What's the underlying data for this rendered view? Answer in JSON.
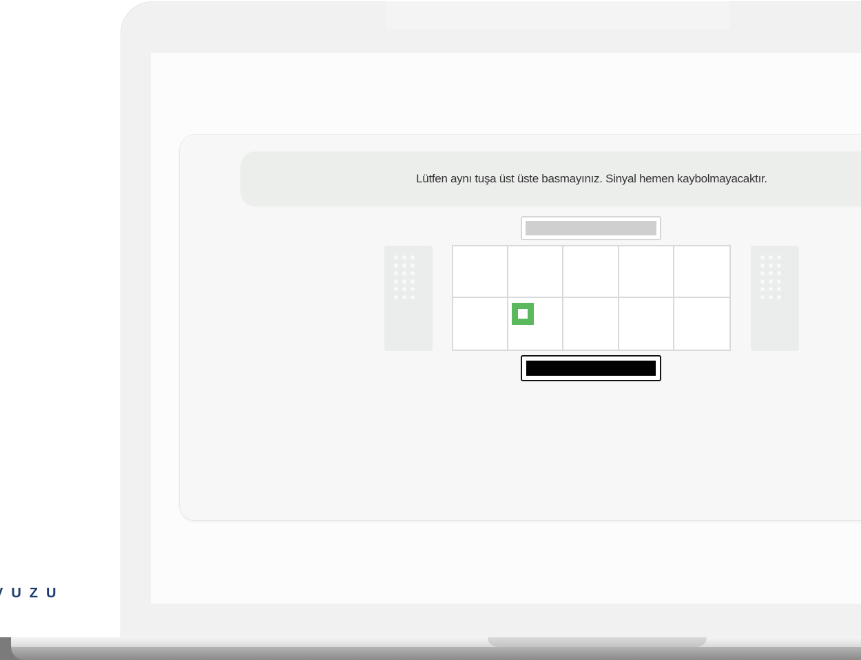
{
  "screen": {
    "banner": {
      "message": "Lütfen aynı tuşa üst üste basmayınız. Sinyal hemen kaybolmayacaktır."
    },
    "grid": {
      "rows": 2,
      "columns": 5,
      "active_signal": {
        "row": 2,
        "column": 2,
        "color": "#5cb85c"
      }
    },
    "top_indicator": {
      "state": "inactive",
      "color": "#cfcfcf"
    },
    "bottom_indicator": {
      "state": "active",
      "color": "#000000"
    }
  },
  "branding": {
    "logo_text": "VUZU",
    "color": "#1c3d6c"
  }
}
